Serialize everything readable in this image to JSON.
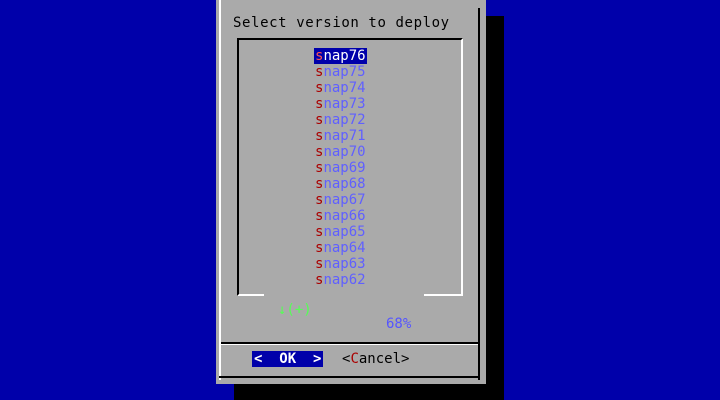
{
  "dialog": {
    "title": "Select version to deploy",
    "items": [
      {
        "label": "snap76",
        "selected": true
      },
      {
        "label": "snap75"
      },
      {
        "label": "snap74"
      },
      {
        "label": "snap73"
      },
      {
        "label": "snap72"
      },
      {
        "label": "snap71"
      },
      {
        "label": "snap70"
      },
      {
        "label": "snap69"
      },
      {
        "label": "snap68"
      },
      {
        "label": "snap67"
      },
      {
        "label": "snap66"
      },
      {
        "label": "snap65"
      },
      {
        "label": "snap64"
      },
      {
        "label": "snap63"
      },
      {
        "label": "snap62"
      }
    ],
    "scroll_indicator": "↓(+)",
    "scroll_percent": "68%",
    "buttons": {
      "ok": "<  OK  >",
      "cancel_prefix": "<",
      "cancel_hotkey": "C",
      "cancel_rest": "ancel>"
    }
  },
  "colors": {
    "background": "#0000aa",
    "dialog": "#aaaaaa",
    "selected_bg": "#0000aa",
    "hotkey": "#aa0000",
    "item_text": "#6060ff"
  }
}
